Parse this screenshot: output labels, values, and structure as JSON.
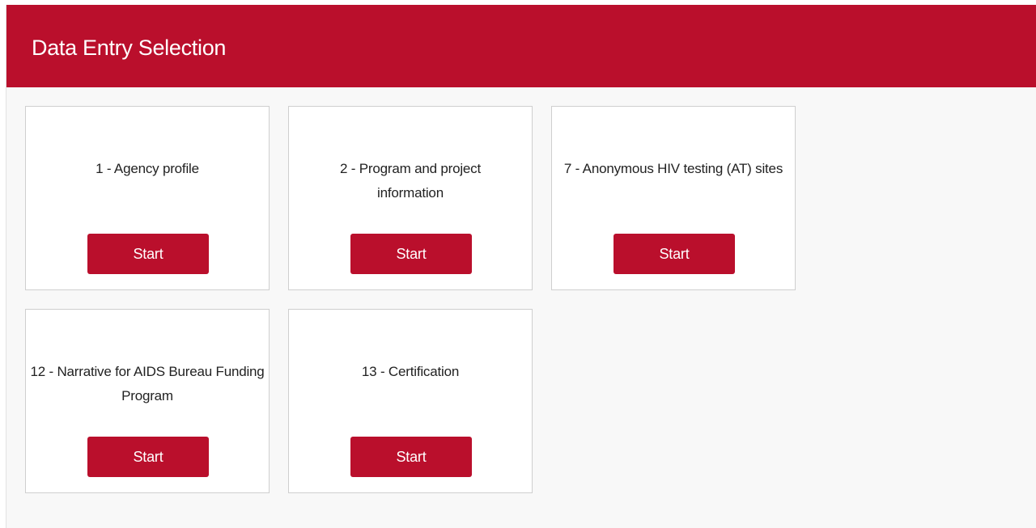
{
  "header": {
    "title": "Data Entry Selection"
  },
  "cards": [
    {
      "title": "1 - Agency profile",
      "button_label": "Start"
    },
    {
      "title": "2 - Program and project information",
      "button_label": "Start"
    },
    {
      "title": "7 - Anonymous HIV testing (AT) sites",
      "button_label": "Start"
    },
    {
      "title": "12 - Narrative for AIDS Bureau Funding Program",
      "button_label": "Start"
    },
    {
      "title": "13 - Certification",
      "button_label": "Start"
    }
  ],
  "colors": {
    "accent": "#ba0f2c",
    "background": "#f8f8f8",
    "card_background": "#ffffff"
  }
}
